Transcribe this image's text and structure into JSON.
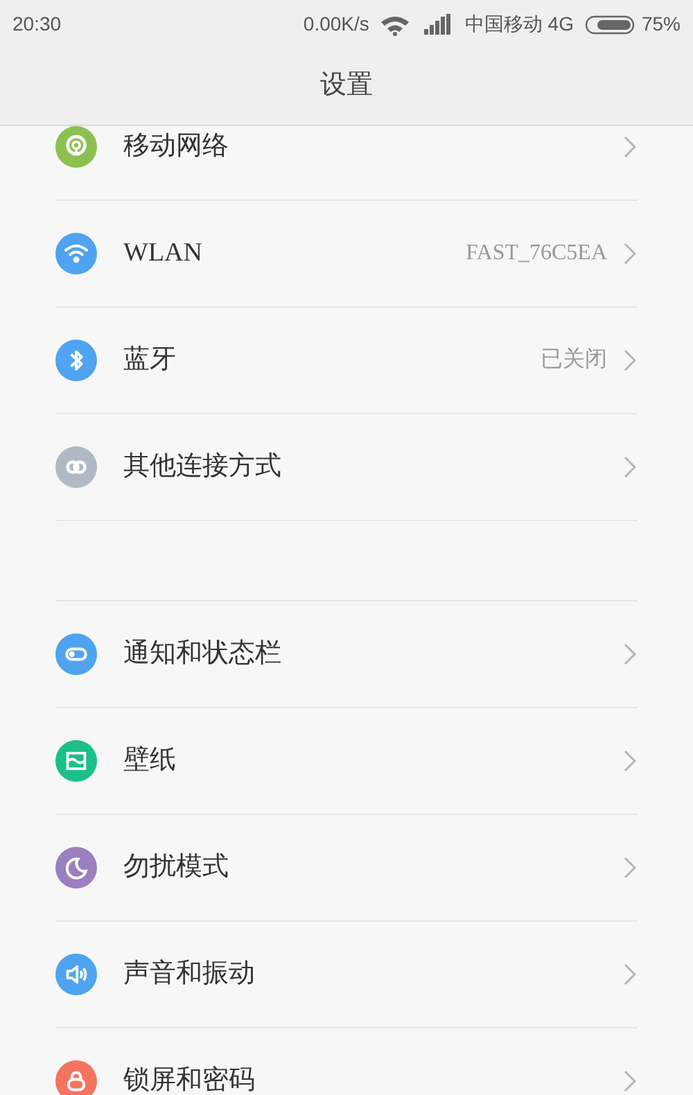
{
  "status_bar": {
    "time": "20:30",
    "speed": "0.00K/s",
    "carrier": "中国移动 4G",
    "battery": "75%"
  },
  "title": "设置",
  "groups": [
    {
      "items": [
        {
          "label": "移动网络",
          "color": "#8cc152"
        },
        {
          "label": "WLAN",
          "value": "FAST_76C5EA",
          "color": "#4fa3f0"
        },
        {
          "label": "蓝牙",
          "value": "已关闭",
          "color": "#4fa3f0"
        },
        {
          "label": "其他连接方式",
          "color": "#b0bac4"
        }
      ]
    },
    {
      "items": [
        {
          "label": "通知和状态栏",
          "color": "#4fa3f0"
        },
        {
          "label": "壁纸",
          "color": "#1bbf8a"
        },
        {
          "label": "勿扰模式",
          "color": "#9b7fc0"
        },
        {
          "label": "声音和振动",
          "color": "#4fa3f0"
        },
        {
          "label": "锁屏和密码",
          "color": "#f5735f"
        }
      ]
    }
  ]
}
